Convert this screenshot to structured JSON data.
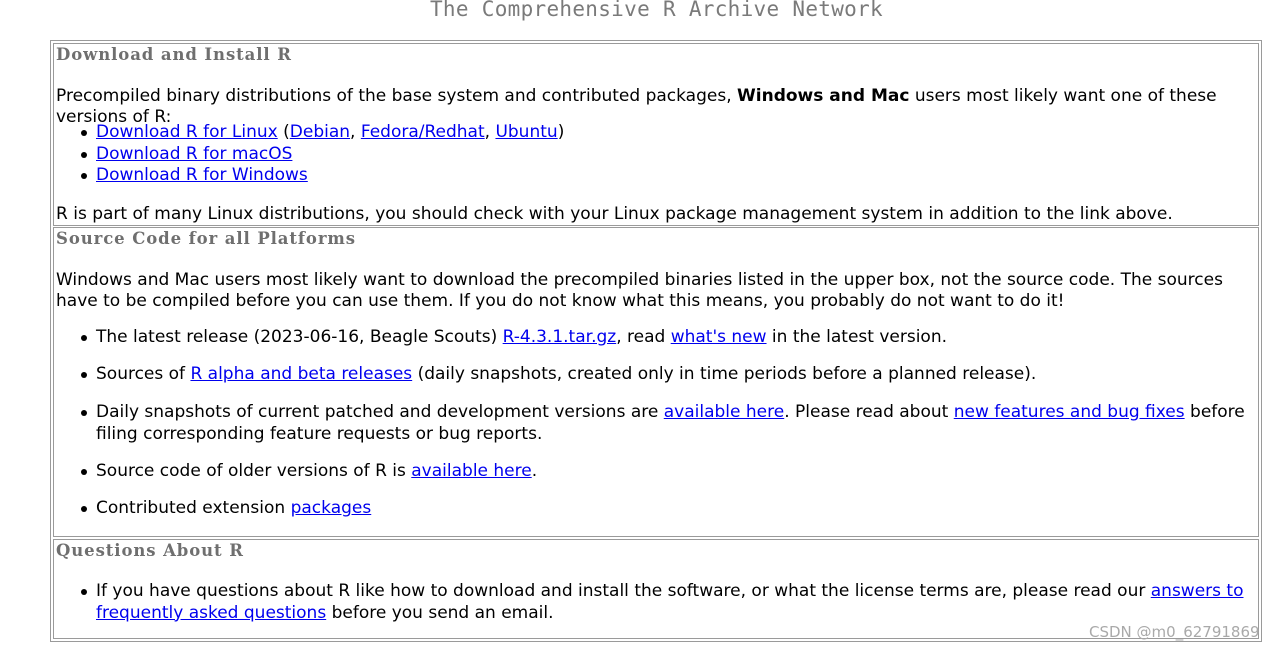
{
  "page_title": "The Comprehensive R Archive Network",
  "download": {
    "heading": "Download and Install R",
    "intro_prefix": "Precompiled binary distributions of the base system and contributed packages, ",
    "intro_bold": "Windows and Mac",
    "intro_suffix": " users most likely want one of these versions of R:",
    "linux_link": "Download R for Linux",
    "linux_open": " (",
    "debian": "Debian",
    "comma1": ", ",
    "fedora": "Fedora/Redhat",
    "comma2": ", ",
    "ubuntu": "Ubuntu",
    "linux_close": ")",
    "macos_link": "Download R for macOS",
    "windows_link": "Download R for Windows",
    "note": "R is part of many Linux distributions, you should check with your Linux package management system in addition to the link above."
  },
  "source": {
    "heading": "Source Code for all Platforms",
    "intro": "Windows and Mac users most likely want to download the precompiled binaries listed in the upper box, not the source code. The sources have to be compiled before you can use them. If you do not know what this means, you probably do not want to do it!",
    "latest_prefix": "The latest release (2023-06-16, Beagle Scouts) ",
    "latest_link": "R-4.3.1.tar.gz",
    "latest_mid": ", read ",
    "whats_new_link": "what's new",
    "latest_suffix": " in the latest version.",
    "alpha_prefix": "Sources of ",
    "alpha_link": "R alpha and beta releases",
    "alpha_suffix": " (daily snapshots, created only in time periods before a planned release).",
    "daily_prefix": "Daily snapshots of current patched and development versions are ",
    "daily_link": "available here",
    "daily_mid": ". Please read about ",
    "features_link": "new features and bug fixes",
    "daily_suffix": " before filing corresponding feature requests or bug reports.",
    "older_prefix": "Source code of older versions of R is ",
    "older_link": "available here",
    "older_suffix": ".",
    "contrib_prefix": "Contributed extension ",
    "contrib_link": "packages"
  },
  "questions": {
    "heading": "Questions About R",
    "text_prefix": "If you have questions about R like how to download and install the software, or what the license terms are, please read our ",
    "faq_link": "answers to frequently asked questions",
    "text_suffix": " before you send an email."
  },
  "watermark": "CSDN @m0_62791869"
}
